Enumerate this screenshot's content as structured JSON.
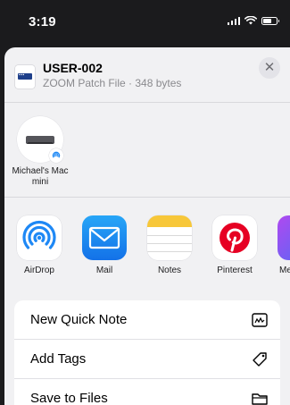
{
  "status_bar": {
    "time": "3:19"
  },
  "file": {
    "name": "USER-002",
    "subtitle": "ZOOM Patch File · 348 bytes",
    "close_symbol": "✕"
  },
  "contacts": [
    {
      "name": "Michael's Mac mini",
      "icon": "mac-mini-icon"
    }
  ],
  "apps": [
    {
      "label": "AirDrop",
      "icon": "airdrop-icon"
    },
    {
      "label": "Mail",
      "icon": "mail-icon"
    },
    {
      "label": "Notes",
      "icon": "notes-icon"
    },
    {
      "label": "Pinterest",
      "icon": "pinterest-icon"
    },
    {
      "label": "Me",
      "icon": "more-app-icon"
    }
  ],
  "actions": [
    {
      "label": "New Quick Note",
      "icon": "quick-note-icon"
    },
    {
      "label": "Add Tags",
      "icon": "tag-icon"
    },
    {
      "label": "Save to Files",
      "icon": "folder-icon"
    }
  ],
  "colors": {
    "sheet_bg": "#f1f1f3",
    "status_bg": "#1b1b1d",
    "accent_blue": "#1e88f5",
    "pinterest_red": "#e60023",
    "notes_yellow": "#f7c739"
  }
}
